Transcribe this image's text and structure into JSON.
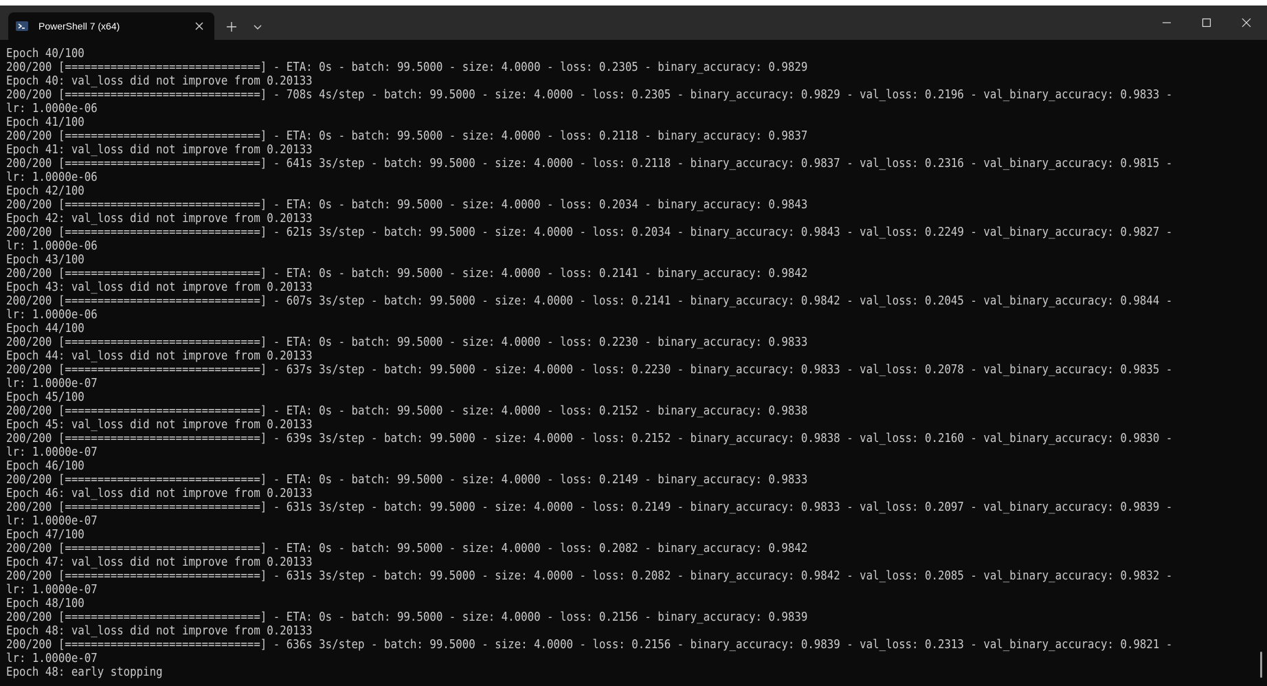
{
  "window": {
    "tab_title": "PowerShell 7 (x64)",
    "tab_icon": "powershell-icon",
    "icons": {
      "close_tab": "close-icon",
      "new_tab": "plus-icon",
      "dropdown": "chevron-down-icon",
      "minimize": "minimize-icon",
      "maximize": "maximize-icon",
      "close_window": "close-icon"
    },
    "colors": {
      "background": "#0c0c0c",
      "titlebar": "#2b2b2b",
      "text": "#cccccc",
      "tab_icon_bg": "#2f4a6e"
    }
  },
  "console": {
    "lines": [
      "Epoch 40/100",
      "200/200 [==============================] - ETA: 0s - batch: 99.5000 - size: 4.0000 - loss: 0.2305 - binary_accuracy: 0.9829",
      "Epoch 40: val_loss did not improve from 0.20133",
      "200/200 [==============================] - 708s 4s/step - batch: 99.5000 - size: 4.0000 - loss: 0.2305 - binary_accuracy: 0.9829 - val_loss: 0.2196 - val_binary_accuracy: 0.9833 -",
      "lr: 1.0000e-06",
      "Epoch 41/100",
      "200/200 [==============================] - ETA: 0s - batch: 99.5000 - size: 4.0000 - loss: 0.2118 - binary_accuracy: 0.9837",
      "Epoch 41: val_loss did not improve from 0.20133",
      "200/200 [==============================] - 641s 3s/step - batch: 99.5000 - size: 4.0000 - loss: 0.2118 - binary_accuracy: 0.9837 - val_loss: 0.2316 - val_binary_accuracy: 0.9815 -",
      "lr: 1.0000e-06",
      "Epoch 42/100",
      "200/200 [==============================] - ETA: 0s - batch: 99.5000 - size: 4.0000 - loss: 0.2034 - binary_accuracy: 0.9843",
      "Epoch 42: val_loss did not improve from 0.20133",
      "200/200 [==============================] - 621s 3s/step - batch: 99.5000 - size: 4.0000 - loss: 0.2034 - binary_accuracy: 0.9843 - val_loss: 0.2249 - val_binary_accuracy: 0.9827 -",
      "lr: 1.0000e-06",
      "Epoch 43/100",
      "200/200 [==============================] - ETA: 0s - batch: 99.5000 - size: 4.0000 - loss: 0.2141 - binary_accuracy: 0.9842",
      "Epoch 43: val_loss did not improve from 0.20133",
      "200/200 [==============================] - 607s 3s/step - batch: 99.5000 - size: 4.0000 - loss: 0.2141 - binary_accuracy: 0.9842 - val_loss: 0.2045 - val_binary_accuracy: 0.9844 -",
      "lr: 1.0000e-06",
      "Epoch 44/100",
      "200/200 [==============================] - ETA: 0s - batch: 99.5000 - size: 4.0000 - loss: 0.2230 - binary_accuracy: 0.9833",
      "Epoch 44: val_loss did not improve from 0.20133",
      "200/200 [==============================] - 637s 3s/step - batch: 99.5000 - size: 4.0000 - loss: 0.2230 - binary_accuracy: 0.9833 - val_loss: 0.2078 - val_binary_accuracy: 0.9835 -",
      "lr: 1.0000e-07",
      "Epoch 45/100",
      "200/200 [==============================] - ETA: 0s - batch: 99.5000 - size: 4.0000 - loss: 0.2152 - binary_accuracy: 0.9838",
      "Epoch 45: val_loss did not improve from 0.20133",
      "200/200 [==============================] - 639s 3s/step - batch: 99.5000 - size: 4.0000 - loss: 0.2152 - binary_accuracy: 0.9838 - val_loss: 0.2160 - val_binary_accuracy: 0.9830 -",
      "lr: 1.0000e-07",
      "Epoch 46/100",
      "200/200 [==============================] - ETA: 0s - batch: 99.5000 - size: 4.0000 - loss: 0.2149 - binary_accuracy: 0.9833",
      "Epoch 46: val_loss did not improve from 0.20133",
      "200/200 [==============================] - 631s 3s/step - batch: 99.5000 - size: 4.0000 - loss: 0.2149 - binary_accuracy: 0.9833 - val_loss: 0.2097 - val_binary_accuracy: 0.9839 -",
      "lr: 1.0000e-07",
      "Epoch 47/100",
      "200/200 [==============================] - ETA: 0s - batch: 99.5000 - size: 4.0000 - loss: 0.2082 - binary_accuracy: 0.9842",
      "Epoch 47: val_loss did not improve from 0.20133",
      "200/200 [==============================] - 631s 3s/step - batch: 99.5000 - size: 4.0000 - loss: 0.2082 - binary_accuracy: 0.9842 - val_loss: 0.2085 - val_binary_accuracy: 0.9832 -",
      "lr: 1.0000e-07",
      "Epoch 48/100",
      "200/200 [==============================] - ETA: 0s - batch: 99.5000 - size: 4.0000 - loss: 0.2156 - binary_accuracy: 0.9839",
      "Epoch 48: val_loss did not improve from 0.20133",
      "200/200 [==============================] - 636s 3s/step - batch: 99.5000 - size: 4.0000 - loss: 0.2156 - binary_accuracy: 0.9839 - val_loss: 0.2313 - val_binary_accuracy: 0.9821 -",
      "lr: 1.0000e-07",
      "Epoch 48: early stopping"
    ]
  }
}
